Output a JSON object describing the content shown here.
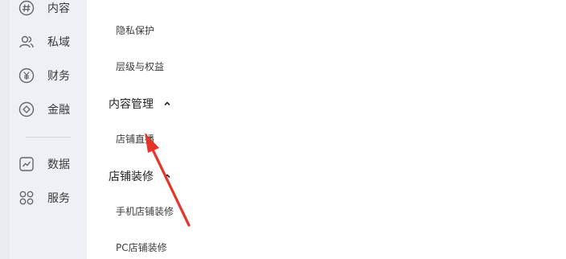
{
  "colors": {
    "accent_arrow": "#e5342a",
    "sidebar_bg": "#eef0f6",
    "rail_bg": "#e9ebee",
    "panel_bg": "#ffffff"
  },
  "sidebar": {
    "items": [
      {
        "label": "内容",
        "icon": "hashtag-icon"
      },
      {
        "label": "私域",
        "icon": "users-icon"
      },
      {
        "label": "财务",
        "icon": "yuan-icon"
      },
      {
        "label": "金融",
        "icon": "finance-circle-icon"
      },
      {
        "label": "数据",
        "icon": "chart-icon"
      },
      {
        "label": "服务",
        "icon": "grid-icon"
      }
    ]
  },
  "submenu": {
    "item_privacy": "隐私保护",
    "item_levels": "层级与权益",
    "group_content": "内容管理",
    "item_live": "店铺直播",
    "group_decor": "店铺装修",
    "item_mobile_decor": "手机店铺装修",
    "item_pc_decor": "PC店铺装修"
  }
}
